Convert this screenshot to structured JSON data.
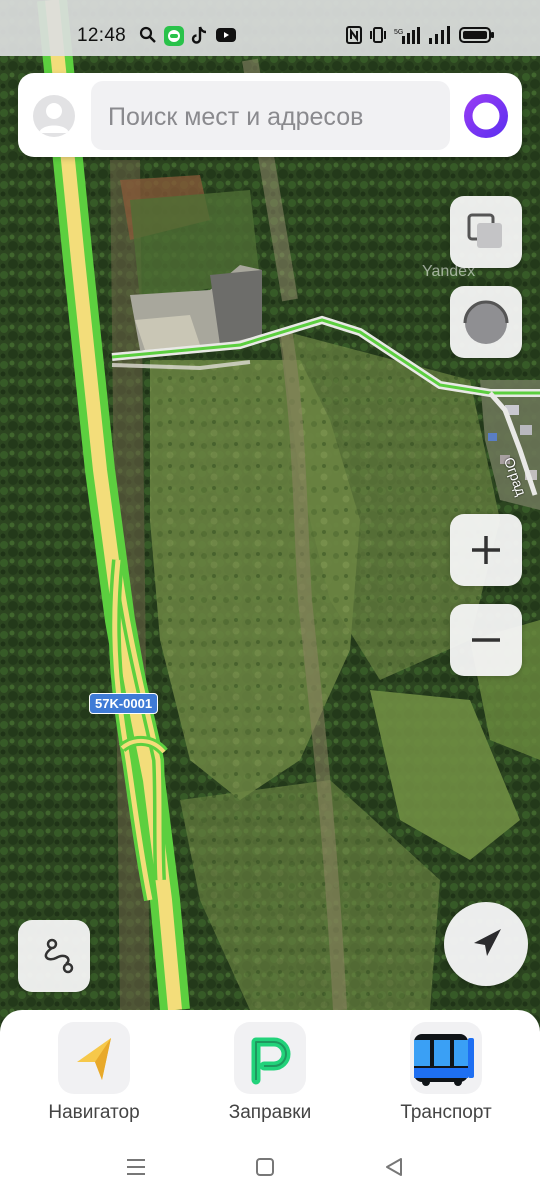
{
  "status_bar": {
    "time": "12:48",
    "icons": [
      "search-icon",
      "messenger-icon",
      "tiktok-icon",
      "youtube-icon",
      "nfc-icon",
      "vibrate-icon",
      "wifi-icon",
      "signal-icon",
      "battery-icon"
    ]
  },
  "search": {
    "placeholder": "Поиск мест и адресов",
    "avatar_icon": "user-avatar-icon",
    "assistant_icon": "alice-assistant-icon"
  },
  "map": {
    "watermark": "Yandex",
    "road_label": "57K-0001",
    "street_label": "Оград",
    "layer_type": "satellite"
  },
  "map_controls": {
    "layers": "layers-icon",
    "overlay": "overlay-toggle-icon",
    "zoom_in": "plus-icon",
    "zoom_out": "minus-icon",
    "route": "route-icon",
    "locate": "navigation-arrow-icon"
  },
  "bottom_panel": {
    "tiles": [
      {
        "label": "Навигатор",
        "icon": "navigator-icon"
      },
      {
        "label": "Заправки",
        "icon": "fuel-p-icon"
      },
      {
        "label": "Транспорт",
        "icon": "bus-icon"
      }
    ]
  },
  "colors": {
    "traffic_green": "#5ccf3f",
    "road_yellow": "#f3dd7a",
    "alice_purple": "#7b3cf2",
    "fuel_green": "#22d27a",
    "bus_blue": "#1e6ff2"
  }
}
